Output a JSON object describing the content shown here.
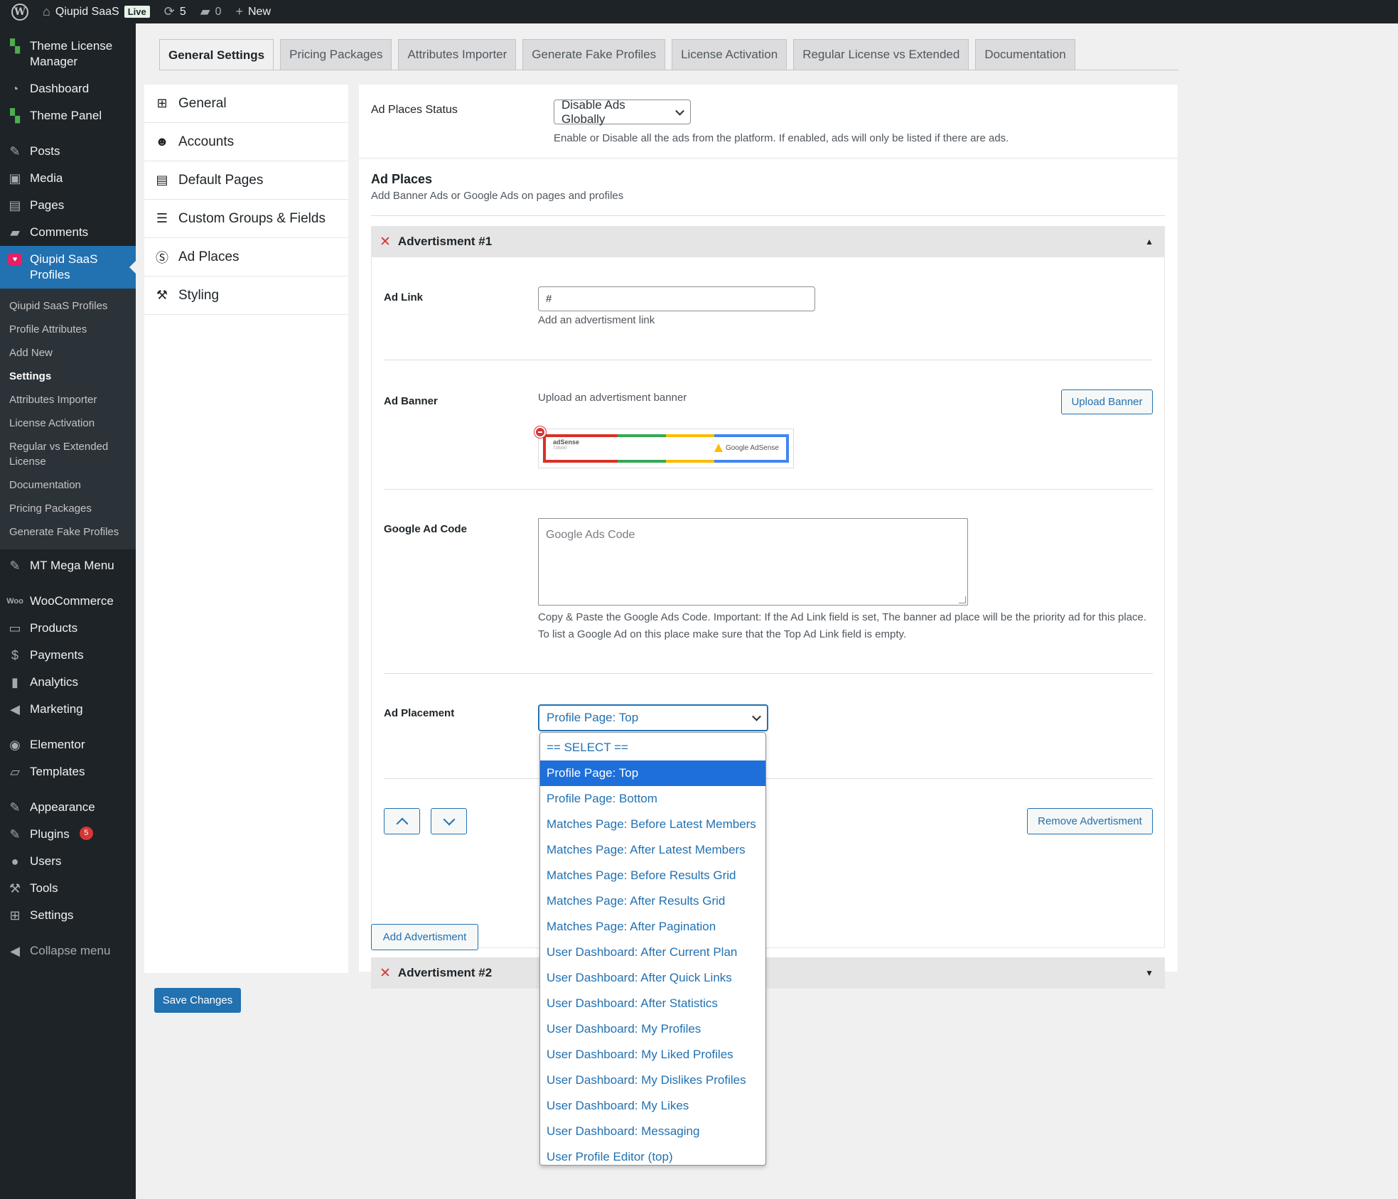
{
  "admin_bar": {
    "site_name": "Qiupid SaaS",
    "live_label": "Live",
    "updates_count": "5",
    "comments_count": "0",
    "new_label": "New"
  },
  "sidebar": {
    "items": [
      {
        "label": "Theme License Manager"
      },
      {
        "label": "Dashboard"
      },
      {
        "label": "Theme Panel"
      },
      {
        "label": "Posts"
      },
      {
        "label": "Media"
      },
      {
        "label": "Pages"
      },
      {
        "label": "Comments"
      },
      {
        "label": "Qiupid SaaS Profiles"
      },
      {
        "label": "MT Mega Menu"
      },
      {
        "label": "WooCommerce"
      },
      {
        "label": "Products"
      },
      {
        "label": "Payments"
      },
      {
        "label": "Analytics"
      },
      {
        "label": "Marketing"
      },
      {
        "label": "Elementor"
      },
      {
        "label": "Templates"
      },
      {
        "label": "Appearance"
      },
      {
        "label": "Plugins"
      },
      {
        "label": "Users"
      },
      {
        "label": "Tools"
      },
      {
        "label": "Settings"
      },
      {
        "label": "Collapse menu"
      }
    ],
    "plugins_badge": "5",
    "submenu": [
      {
        "label": "Qiupid SaaS Profiles"
      },
      {
        "label": "Profile Attributes"
      },
      {
        "label": "Add New"
      },
      {
        "label": "Settings"
      },
      {
        "label": "Attributes Importer"
      },
      {
        "label": "License Activation"
      },
      {
        "label": "Regular vs Extended License"
      },
      {
        "label": "Documentation"
      },
      {
        "label": "Pricing Packages"
      },
      {
        "label": "Generate Fake Profiles"
      }
    ]
  },
  "tabs": [
    {
      "label": "General Settings"
    },
    {
      "label": "Pricing Packages"
    },
    {
      "label": "Attributes Importer"
    },
    {
      "label": "Generate Fake Profiles"
    },
    {
      "label": "License Activation"
    },
    {
      "label": "Regular License vs Extended"
    },
    {
      "label": "Documentation"
    }
  ],
  "left_nav": [
    {
      "label": "General"
    },
    {
      "label": "Accounts"
    },
    {
      "label": "Default Pages"
    },
    {
      "label": "Custom Groups & Fields"
    },
    {
      "label": "Ad Places"
    },
    {
      "label": "Styling"
    }
  ],
  "main": {
    "status_label": "Ad Places Status",
    "status_value": "Disable Ads Globally",
    "status_desc": "Enable or Disable all the ads from the platform. If enabled, ads will only be listed if there are ads.",
    "section_title": "Ad Places",
    "section_desc": "Add Banner Ads or Google Ads on pages and profiles",
    "ad1": {
      "title": "Advertisment #1",
      "link_label": "Ad Link",
      "link_value": "#",
      "link_desc": "Add an advertisment link",
      "banner_label": "Ad Banner",
      "banner_desc": "Upload an advertisment banner",
      "upload_label": "Upload Banner",
      "banner_adsense_word": "adSense",
      "banner_size": "728x90",
      "banner_logo_text": "Google AdSense",
      "code_label": "Google Ad Code",
      "code_placeholder": "Google Ads Code",
      "code_desc": "Copy & Paste the Google Ads Code. Important: If the Ad Link field is set, The banner ad place will be the priority ad for this place. To list a Google Ad on this place make sure that the Top Ad Link field is empty.",
      "placement_label": "Ad Placement",
      "placement_value": "Profile Page: Top",
      "remove_label": "Remove Advertisment"
    },
    "ad2": {
      "title": "Advertisment #2"
    },
    "add_label": "Add Advertisment"
  },
  "save_label": "Save Changes",
  "dropdown_options": [
    "== SELECT ==",
    "Profile Page: Top",
    "Profile Page: Bottom",
    "Matches Page: Before Latest Members",
    "Matches Page: After Latest Members",
    "Matches Page: Before Results Grid",
    "Matches Page: After Results Grid",
    "Matches Page: After Pagination",
    "User Dashboard: After Current Plan",
    "User Dashboard: After Quick Links",
    "User Dashboard: After Statistics",
    "User Dashboard: My Profiles",
    "User Dashboard: My Liked Profiles",
    "User Dashboard: My Dislikes Profiles",
    "User Dashboard: My Likes",
    "User Dashboard: Messaging",
    "User Profile Editor (top)"
  ],
  "colors": {
    "accent": "#2271b1",
    "sidebar_bg": "#1d2327",
    "danger": "#d63638",
    "selected_option": "#1e6fd9"
  }
}
